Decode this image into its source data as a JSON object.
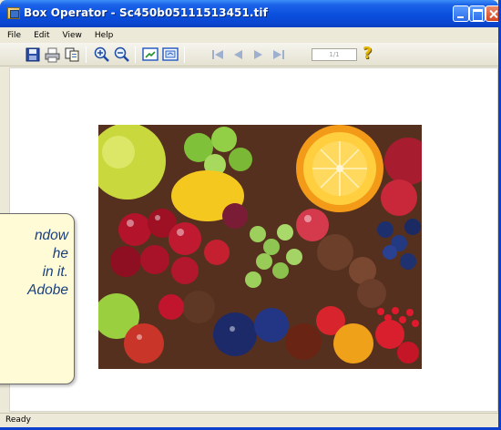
{
  "window": {
    "title": "Box Operator - Sc450b05111513451.tif",
    "icon": "app-icon"
  },
  "menu": {
    "items": [
      {
        "label": "File"
      },
      {
        "label": "Edit"
      },
      {
        "label": "View"
      },
      {
        "label": "Help"
      }
    ]
  },
  "toolbar": {
    "buttons": [
      {
        "icon": "save-icon"
      },
      {
        "icon": "print-icon"
      },
      {
        "icon": "copy-icon"
      },
      {
        "icon": "zoom-in-icon"
      },
      {
        "icon": "zoom-out-icon"
      },
      {
        "icon": "fit-to-window-icon"
      },
      {
        "icon": "actual-size-icon"
      },
      {
        "icon": "first-page-icon"
      },
      {
        "icon": "previous-page-icon"
      },
      {
        "icon": "next-page-icon"
      },
      {
        "icon": "last-page-icon"
      },
      {
        "icon": "help-icon"
      }
    ],
    "page_indicator": "1/1"
  },
  "status": {
    "text": "Ready"
  },
  "callout": {
    "lines": [
      "ndow",
      "he",
      "in it.",
      "Adobe"
    ]
  },
  "colors": {
    "title_bar": "#0a4fdd",
    "window_face": "#ece9d8",
    "callout_background": "#fffbd6",
    "callout_text": "#1a3f7d"
  }
}
